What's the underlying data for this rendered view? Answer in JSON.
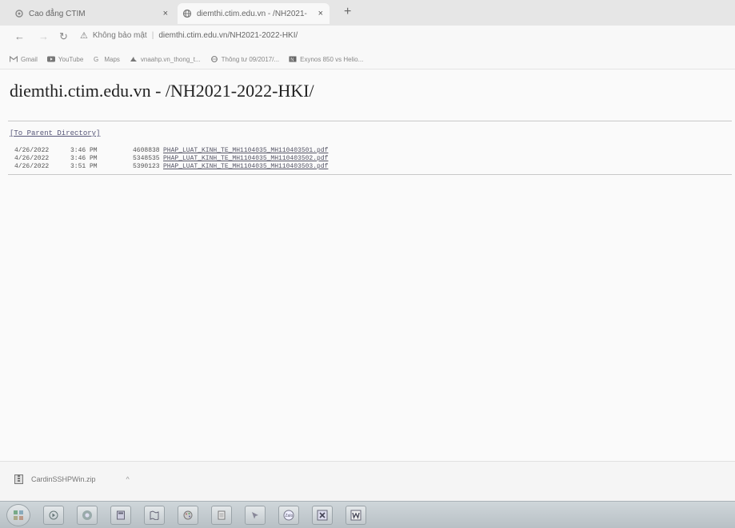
{
  "browser": {
    "tabs": [
      {
        "title": "Cao đẳng CTIM"
      },
      {
        "title": "diemthi.ctim.edu.vn - /NH2021-"
      }
    ],
    "new_tab": "+",
    "close_glyph": "×",
    "security_label": "Không bảo mật",
    "url": "diemthi.ctim.edu.vn/NH2021-2022-HKI/",
    "bookmarks": [
      {
        "label": "Gmail",
        "icon": "gmail-icon"
      },
      {
        "label": "YouTube",
        "icon": "youtube-icon"
      },
      {
        "label": "Maps",
        "icon": "maps-icon"
      },
      {
        "label": "vnaahp.vn_thong_t...",
        "icon": "bookmark-icon"
      },
      {
        "label": "Thông tư 09/2017/...",
        "icon": "globe-icon"
      },
      {
        "label": "Exynos 850 vs Helio...",
        "icon": "bookmark-icon"
      }
    ]
  },
  "page": {
    "title": "diemthi.ctim.edu.vn - /NH2021-2022-HKI/",
    "parent_link": "[To Parent Directory]",
    "files": [
      {
        "date": "4/26/2022",
        "time": "3:46 PM",
        "size": "4608838",
        "name": "PHAP_LUAT_KINH_TE_MH1104035_MH110403501.pdf"
      },
      {
        "date": "4/26/2022",
        "time": "3:46 PM",
        "size": "5348535",
        "name": "PHAP_LUAT_KINH_TE_MH1104035_MH110403502.pdf"
      },
      {
        "date": "4/26/2022",
        "time": "3:51 PM",
        "size": "5390123",
        "name": "PHAP_LUAT_KINH_TE_MH1104035_MH110403503.pdf"
      }
    ]
  },
  "downloads": {
    "item": "CardinSSHPWin.zip",
    "chevron": "^"
  },
  "taskbar": {
    "items": [
      "start-orb",
      "media-player",
      "chrome",
      "calculator",
      "maps",
      "paint",
      "notepad",
      "cursor",
      "zalo",
      "excel",
      "word"
    ]
  }
}
